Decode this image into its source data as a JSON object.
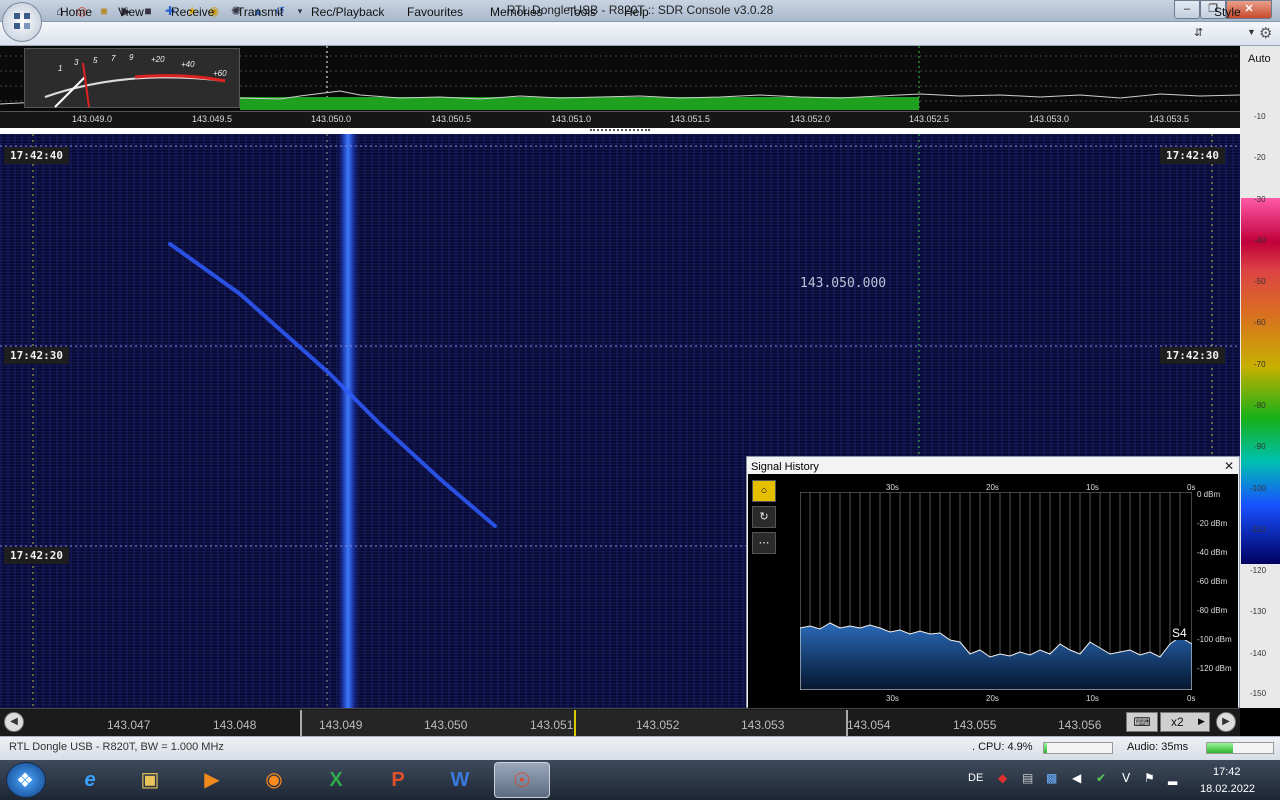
{
  "window": {
    "title": "RTL Dongle USB - R820T :: SDR Console v3.0.28"
  },
  "menu": {
    "items": [
      "Home",
      "View",
      "Receive",
      "Transmit",
      "Rec/Playback",
      "Favourites",
      "Memories",
      "Tools",
      "Help"
    ],
    "style_label": "Style"
  },
  "spectrum": {
    "auto_label": "Auto",
    "freq_labels": [
      "143.049.0",
      "143.049.5",
      "143.050.0",
      "143.050.5",
      "143.051.0",
      "143.051.5",
      "143.052.0",
      "143.052.5",
      "143.053.0",
      "143.053.5"
    ],
    "smeter_labels": [
      "1",
      "3",
      "5",
      "7",
      "9",
      "+20",
      "+40",
      "+60"
    ]
  },
  "waterfall": {
    "timestamps": [
      "17:42:40",
      "17:42:30",
      "17:42:20"
    ],
    "freq_display": "143.050.000"
  },
  "level_scale": [
    "-10",
    "-20",
    "-30",
    "-40",
    "-50",
    "-60",
    "-70",
    "-80",
    "-90",
    "-100",
    "-110",
    "-120",
    "-130",
    "-140",
    "-150"
  ],
  "freq_bar": {
    "labels": [
      "143.047",
      "143.048",
      "143.049",
      "143.050",
      "143.051",
      "143.052",
      "143.053",
      "143.054",
      "143.055",
      "143.056"
    ],
    "zoom": "x2"
  },
  "signal_history": {
    "title": "Signal History",
    "time_labels": [
      "30s",
      "20s",
      "10s",
      "0s"
    ],
    "db_labels": [
      "0 dBm",
      "-20 dBm",
      "-40 dBm",
      "-60 dBm",
      "-80 dBm",
      "-100 dBm",
      "-120 dBm"
    ],
    "s_value": "S4"
  },
  "status": {
    "device": "RTL Dongle USB - R820T, BW = 1.000 MHz",
    "cpu": ". CPU: 4.9%",
    "cpu_percent": 4.9,
    "audio": "Audio: 35ms"
  },
  "taskbar": {
    "language": "DE",
    "time": "17:42",
    "date": "18.02.2022"
  },
  "colors": {
    "waterfall_bg": "#0a0c38",
    "signal": "#2a6cff",
    "spectrum_green": "#1fa01f"
  }
}
